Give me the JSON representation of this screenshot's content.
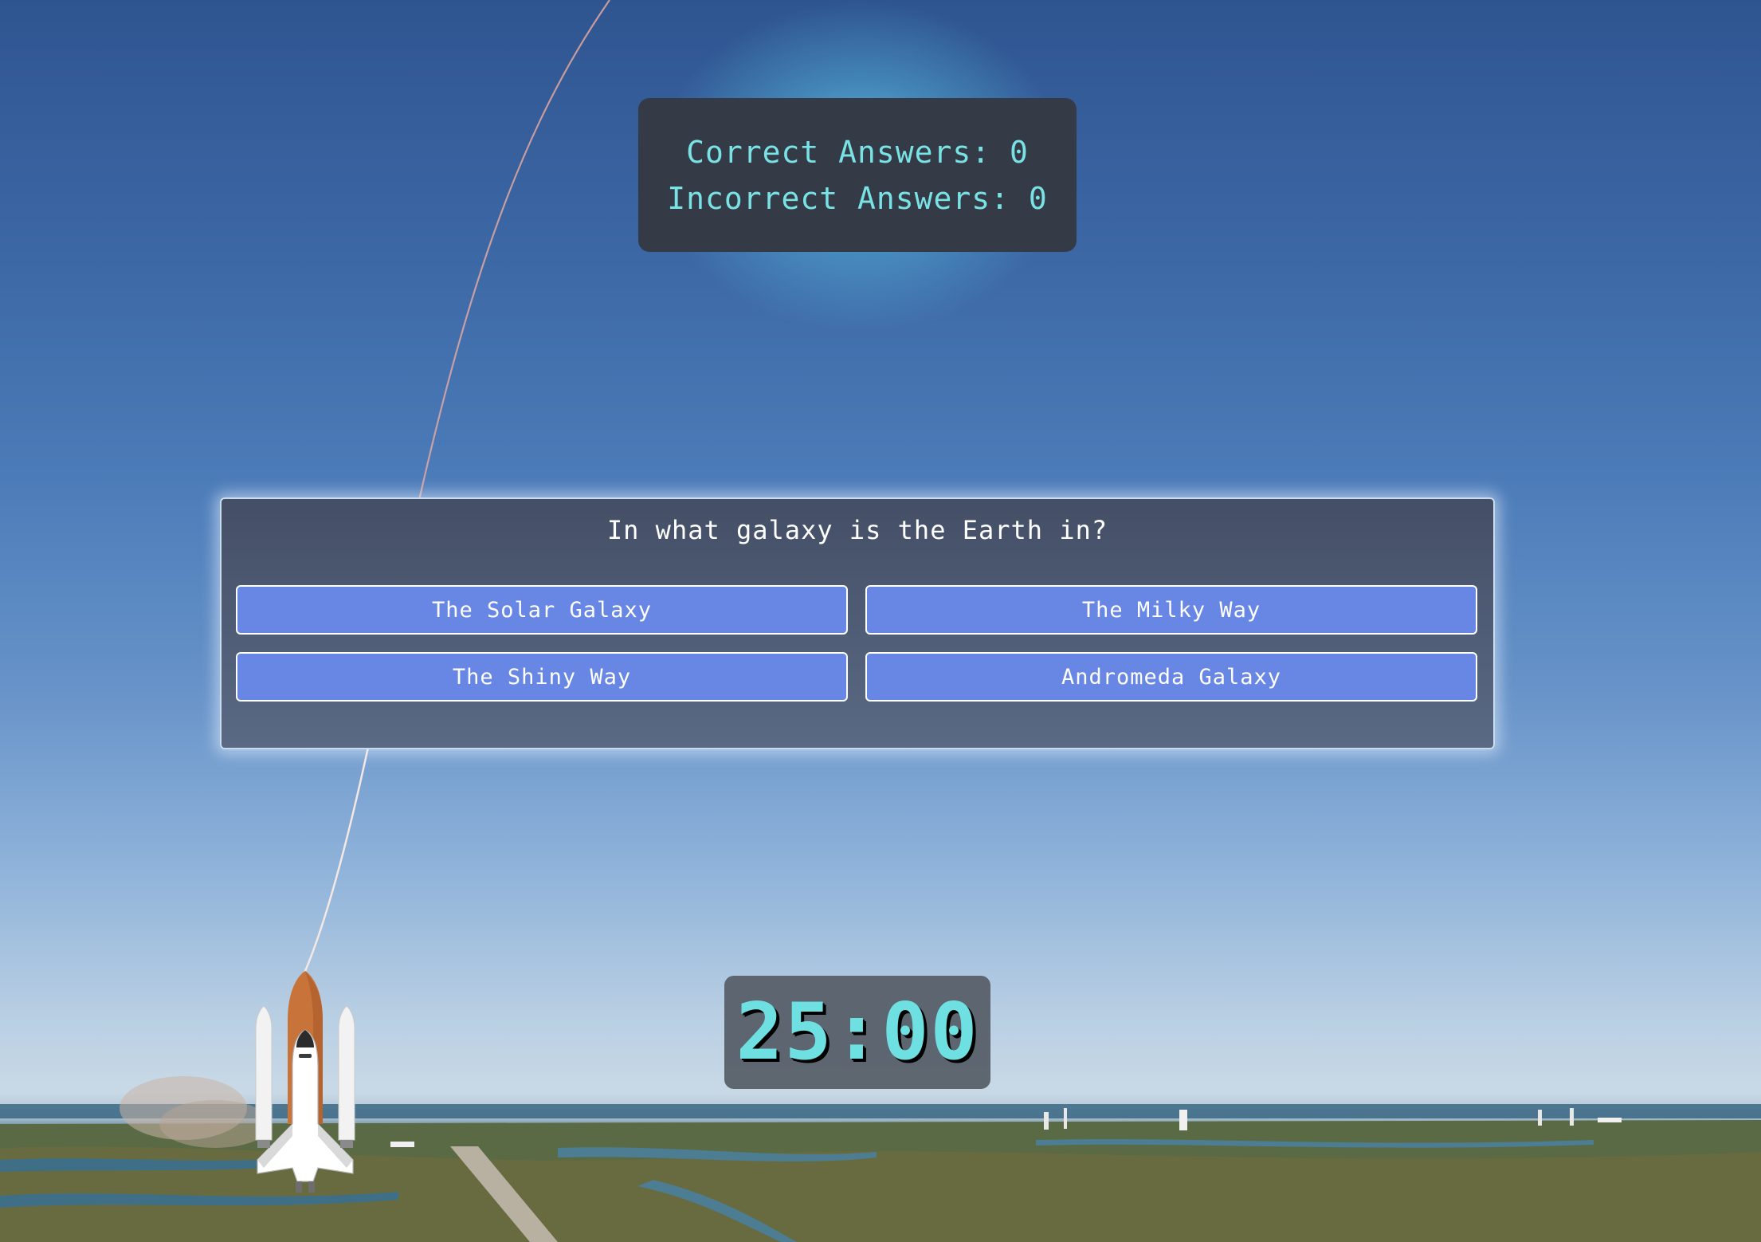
{
  "scoreboard": {
    "correct_label": "Correct Answers: 0",
    "incorrect_label": "Incorrect Answers: 0"
  },
  "quiz": {
    "question": "In what galaxy is the Earth in?",
    "answers": [
      "The Solar Galaxy",
      "The Milky Way",
      "The Shiny Way",
      "Andromeda Galaxy"
    ]
  },
  "timer": {
    "value": "25:00"
  },
  "colors": {
    "score_text": "#79e2e4",
    "answer_button": "#6887e5",
    "timer_text": "#6fe0e2",
    "panel_dark": "#343b47"
  }
}
